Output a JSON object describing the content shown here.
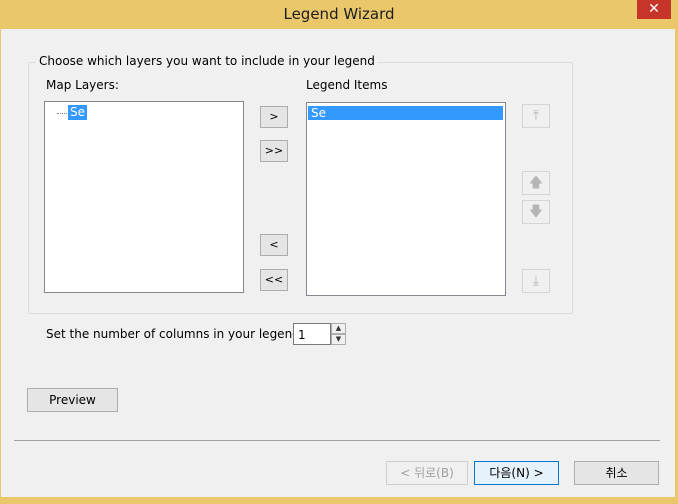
{
  "window": {
    "title": "Legend Wizard",
    "close_label": "✕"
  },
  "group": {
    "label": "Choose which layers you want to include in your legend"
  },
  "map_layers": {
    "label": "Map Layers:",
    "items": [
      "Se"
    ]
  },
  "legend_items": {
    "label": "Legend Items",
    "items": [
      "Se"
    ]
  },
  "move_buttons": {
    "add": ">",
    "add_all": ">>",
    "remove": "<",
    "remove_all": "<<"
  },
  "order_buttons": {
    "top": "⤒",
    "up": "🡅",
    "down": "🡇",
    "bottom": "⤓"
  },
  "columns": {
    "label": "Set the number of columns in your legend:",
    "value": "1"
  },
  "preview_label": "Preview",
  "footer": {
    "back_label": "< 뒤로(B)",
    "next_label": "다음(N) >",
    "cancel_label": "취소"
  }
}
